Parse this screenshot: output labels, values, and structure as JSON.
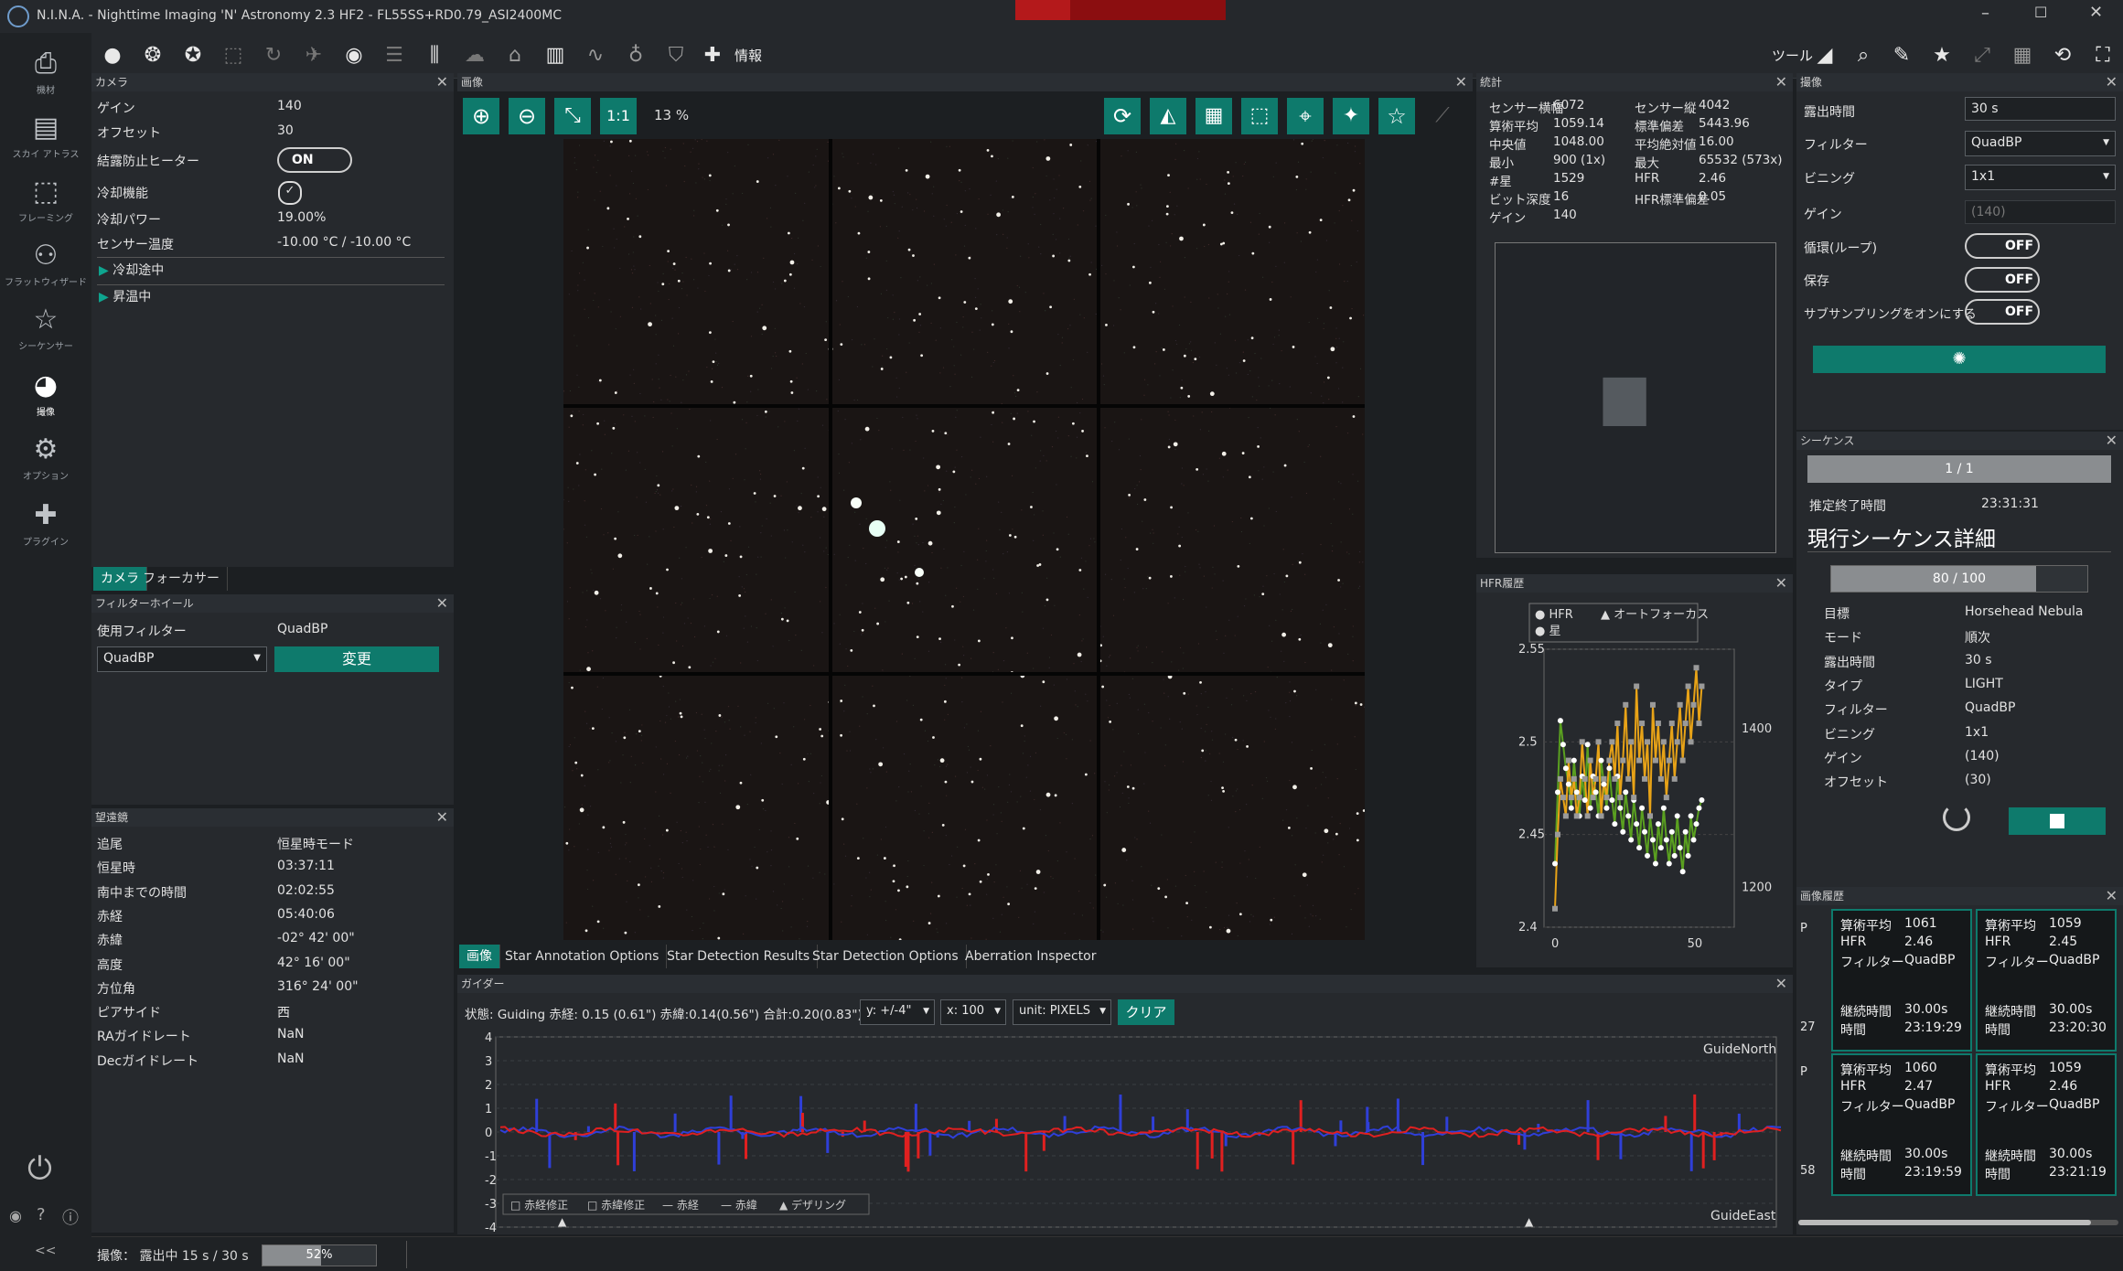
{
  "window": {
    "title": "N.I.N.A. - Nighttime Imaging 'N' Astronomy 2.3 HF2   -  FL55SS+RD0.79_ASI2400MC"
  },
  "toolbar": {
    "info_label": "情報",
    "tools_label": "ツール"
  },
  "sidebar": {
    "items": [
      {
        "label": "機材",
        "icon": "camera-icon"
      },
      {
        "label": "スカイ アトラス",
        "icon": "atlas-icon"
      },
      {
        "label": "フレーミング",
        "icon": "framing-icon"
      },
      {
        "label": "フラットウィザード",
        "icon": "flat-wizard-icon"
      },
      {
        "label": "シーケンサー",
        "icon": "sequencer-icon"
      },
      {
        "label": "撮像",
        "icon": "imaging-icon"
      },
      {
        "label": "オプション",
        "icon": "gear-icon"
      },
      {
        "label": "プラグイン",
        "icon": "plugin-icon"
      }
    ],
    "collapse": "<<"
  },
  "camera": {
    "header": "カメラ",
    "rows": [
      {
        "label": "ゲイン",
        "value": "140"
      },
      {
        "label": "オフセット",
        "value": "30"
      },
      {
        "label": "結露防止ヒーター",
        "value": "ON"
      },
      {
        "label": "冷却機能",
        "value": "✓"
      },
      {
        "label": "冷却パワー",
        "value": "19.00%"
      },
      {
        "label": "センサー温度",
        "value": "-10.00 °C / -10.00 °C"
      }
    ],
    "cooling": "冷却途中",
    "warming": "昇温中",
    "tabs": [
      "カメラ",
      "フォーカサー"
    ]
  },
  "filterwheel": {
    "header": "フィルターホイール",
    "label": "使用フィルター",
    "value": "QuadBP",
    "selected": "QuadBP",
    "button": "変更"
  },
  "telescope": {
    "header": "望遠鏡",
    "rows": [
      {
        "label": "追尾",
        "value": "恒星時モード"
      },
      {
        "label": "恒星時",
        "value": "03:37:11"
      },
      {
        "label": "南中までの時間",
        "value": "02:02:55"
      },
      {
        "label": "赤経",
        "value": "05:40:06"
      },
      {
        "label": "赤緯",
        "value": "-02° 42' 00\""
      },
      {
        "label": "高度",
        "value": "42° 16' 00\""
      },
      {
        "label": "方位角",
        "value": "316° 24' 00\""
      },
      {
        "label": "ピアサイド",
        "value": "西"
      },
      {
        "label": "RAガイドレート",
        "value": "NaN"
      },
      {
        "label": "Decガイドレート",
        "value": "NaN"
      }
    ]
  },
  "image": {
    "header": "画像",
    "zoom": "13 %",
    "one_to_one": "1:1",
    "tabs": [
      "画像",
      "Star Annotation Options",
      "Star Detection Results",
      "Star Detection Options",
      "Aberration Inspector"
    ]
  },
  "stats": {
    "header": "統計",
    "left": [
      {
        "label": "センサー横幅",
        "value": "6072"
      },
      {
        "label": "算術平均",
        "value": "1059.14"
      },
      {
        "label": "中央値",
        "value": "1048.00"
      },
      {
        "label": "最小",
        "value": "900 (1x)"
      },
      {
        "label": "#星",
        "value": "1529"
      },
      {
        "label": "ビット深度",
        "value": "16"
      },
      {
        "label": "ゲイン",
        "value": "140"
      }
    ],
    "right": [
      {
        "label": "センサー縦",
        "value": "4042"
      },
      {
        "label": "標準偏差",
        "value": "5443.96"
      },
      {
        "label": "平均絶対値",
        "value": "16.00"
      },
      {
        "label": "最大",
        "value": "65532 (573x)"
      },
      {
        "label": "HFR",
        "value": "2.46"
      },
      {
        "label": "HFR標準偏差",
        "value": "0.05"
      }
    ]
  },
  "hfr": {
    "header": "HFR履歴",
    "legend": [
      "HFR",
      "オートフォーカス",
      "星"
    ],
    "y_ticks": [
      "2.55",
      "2.5",
      "2.45",
      "2.4"
    ],
    "y2_ticks": [
      "1400",
      "1200"
    ],
    "x_ticks": [
      "0",
      "50"
    ]
  },
  "chart_data": {
    "type": "line",
    "title": "",
    "xlabel": "",
    "ylabel": "",
    "ylim": [
      2.4,
      2.55
    ],
    "y2lim": [
      1150,
      1500
    ],
    "xlim": [
      0,
      70
    ],
    "series": [
      {
        "name": "HFR",
        "values": [
          2.41,
          2.45,
          2.48,
          2.47,
          2.46,
          2.49,
          2.47,
          2.48,
          2.46,
          2.47,
          2.5,
          2.48,
          2.46,
          2.49,
          2.47,
          2.48,
          2.5,
          2.46,
          2.48,
          2.47,
          2.49,
          2.5,
          2.48,
          2.51,
          2.47,
          2.49,
          2.52,
          2.48,
          2.5,
          2.47,
          2.53,
          2.49,
          2.51,
          2.48,
          2.5,
          2.46,
          2.52,
          2.49,
          2.51,
          2.48,
          2.5,
          2.47,
          2.49,
          2.51,
          2.48,
          2.5,
          2.52,
          2.49,
          2.51,
          2.53,
          2.5,
          2.52,
          2.54,
          2.51,
          2.53
        ]
      },
      {
        "name": "星",
        "values": [
          1230,
          1320,
          1410,
          1380,
          1350,
          1330,
          1300,
          1360,
          1320,
          1290,
          1340,
          1310,
          1380,
          1300,
          1340,
          1320,
          1290,
          1360,
          1330,
          1300,
          1350,
          1310,
          1280,
          1340,
          1300,
          1270,
          1320,
          1290,
          1260,
          1310,
          1280,
          1250,
          1300,
          1270,
          1240,
          1290,
          1260,
          1230,
          1280,
          1250,
          1300,
          1260,
          1230,
          1270,
          1240,
          1290,
          1250,
          1220,
          1270,
          1240,
          1290,
          1260,
          1280,
          1300,
          1310
        ]
      }
    ]
  },
  "guider": {
    "header": "ガイダー",
    "status": "状態: Guiding 赤経: 0.15 (0.61\") 赤緯:0.14(0.56\") 合計:0.20(0.83\")",
    "y_sel": "y: +/-4\"",
    "x_sel": "x: 100",
    "unit_sel": "unit: PIXELS",
    "clear": "クリア",
    "y_ticks": [
      "4",
      "3",
      "2",
      "1",
      "0",
      "-1",
      "-2",
      "-3",
      "-4"
    ],
    "north": "GuideNorth",
    "east": "GuideEast",
    "legend": [
      "赤経修正",
      "赤緯修正",
      "赤経",
      "赤緯",
      "デザリング"
    ]
  },
  "imaging": {
    "header": "撮像",
    "rows": [
      {
        "label": "露出時間",
        "value": "30 s"
      },
      {
        "label": "フィルター",
        "value": "QuadBP"
      },
      {
        "label": "ビニング",
        "value": "1x1"
      },
      {
        "label": "ゲイン",
        "value": "(140)"
      },
      {
        "label": "循環(ループ)",
        "value": "OFF"
      },
      {
        "label": "保存",
        "value": "OFF"
      },
      {
        "label": "サブサンプリングをオンにする",
        "value": "OFF"
      }
    ]
  },
  "sequence": {
    "header": "シーケンス",
    "progress": "1 / 1",
    "eta_label": "推定終了時間",
    "eta": "23:31:31",
    "detail_title": "現行シーケンス詳細",
    "count": "80 / 100",
    "count_fraction": 0.8,
    "rows": [
      {
        "label": "目標",
        "value": "Horsehead Nebula"
      },
      {
        "label": "モード",
        "value": "順次"
      },
      {
        "label": "露出時間",
        "value": "30 s"
      },
      {
        "label": "タイプ",
        "value": "LIGHT"
      },
      {
        "label": "フィルター",
        "value": "QuadBP"
      },
      {
        "label": "ビニング",
        "value": "1x1"
      },
      {
        "label": "ゲイン",
        "value": "(140)"
      },
      {
        "label": "オフセット",
        "value": "(30)"
      }
    ]
  },
  "history": {
    "header": "画像履歴",
    "items": [
      {
        "mean": "1061",
        "hfr": "2.46",
        "filter": "QuadBP",
        "dur": "30.00s",
        "time": "23:19:29"
      },
      {
        "mean": "1059",
        "hfr": "2.45",
        "filter": "QuadBP",
        "dur": "30.00s",
        "time": "23:20:30"
      },
      {
        "mean": "1060",
        "hfr": "2.47",
        "filter": "QuadBP",
        "dur": "30.00s",
        "time": "23:19:59"
      },
      {
        "mean": "1059",
        "hfr": "2.46",
        "filter": "QuadBP",
        "dur": "30.00s",
        "time": "23:21:19"
      }
    ],
    "labels": {
      "mean": "算術平均",
      "hfr": "HFR",
      "filter": "フィルター",
      "dur": "継続時間",
      "time": "時間"
    },
    "edge": [
      "P",
      "27",
      "P",
      "58"
    ]
  },
  "statusbar": {
    "text": "撮像：  露出中 15 s / 30 s",
    "progress": "52%",
    "fraction": 0.52
  },
  "colors": {
    "accent": "#0e7a6c",
    "hfr": "#e8a317",
    "stars": "#9a9a9a",
    "ra": "#2f3fd8",
    "dec": "#e02020",
    "green": "#5aa020"
  }
}
